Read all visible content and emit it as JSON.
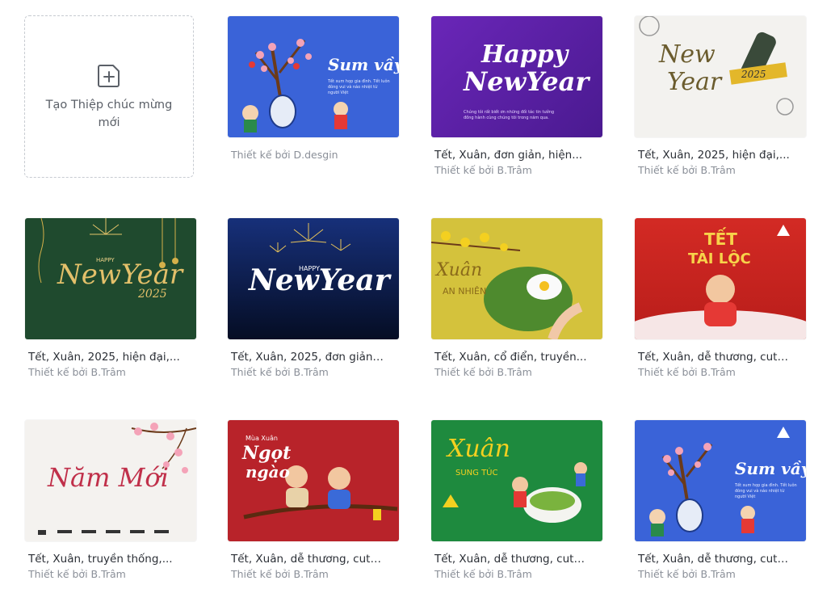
{
  "create_card": {
    "label": "Tạo Thiệp chúc mừng mới",
    "icon": "add-page-icon"
  },
  "designer_prefix": "Thiết kế bởi",
  "cards": [
    {
      "title": "",
      "designer": "Thiết kế bởi D.desgin",
      "bg": "#3a63d8",
      "art": "Sum vầy"
    },
    {
      "title": "Tết, Xuân, đơn giản, hiện...",
      "designer": "Thiết kế bởi B.Trâm",
      "bg": "#5a1fa3",
      "art": "Happy New Year"
    },
    {
      "title": "Tết, Xuân, 2025, hiện đại,...",
      "designer": "Thiết kế bởi B.Trâm",
      "bg": "#f3f2ef",
      "art": "New Year 2025"
    },
    {
      "title": "Tết, Xuân, 2025, hiện đại,...",
      "designer": "Thiết kế bởi B.Trâm",
      "bg": "#1f4a2e",
      "art": "Happy New Year 2025"
    },
    {
      "title": "Tết, Xuân, 2025, đơn giản,...",
      "designer": "Thiết kế bởi B.Trâm",
      "bg": "#0d1f5c",
      "art": "Happy New Year"
    },
    {
      "title": "Tết, Xuân, cổ điển, truyền...",
      "designer": "Thiết kế bởi B.Trâm",
      "bg": "#d4c23c",
      "art": "Xuân An Nhiên"
    },
    {
      "title": "Tết, Xuân, dễ thương, cute...",
      "designer": "Thiết kế bởi B.Trâm",
      "bg": "#cf2520",
      "art": "Tết Tài Lộc"
    },
    {
      "title": "Tết, Xuân, truyền thống,...",
      "designer": "Thiết kế bởi B.Trâm",
      "bg": "#f4f2ef",
      "art": "Năm Mới"
    },
    {
      "title": "Tết, Xuân, dễ thương, cute...",
      "designer": "Thiết kế bởi B.Trâm",
      "bg": "#b8232a",
      "art": "Mùa Xuân Ngọt ngào"
    },
    {
      "title": "Tết, Xuân, dễ thương, cute...",
      "designer": "Thiết kế bởi B.Trâm",
      "bg": "#1e8a3e",
      "art": "Xuân Sung Túc"
    },
    {
      "title": "Tết, Xuân, dễ thương, cute...",
      "designer": "Thiết kế bởi B.Trâm",
      "bg": "#3a63d8",
      "art": "Sum vầy"
    }
  ]
}
